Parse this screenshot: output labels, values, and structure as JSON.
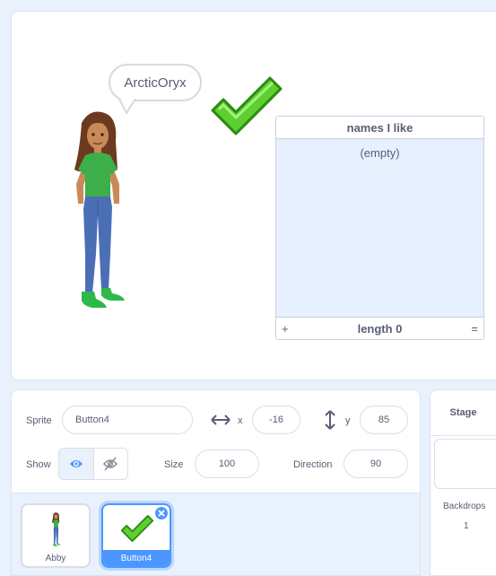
{
  "stage": {
    "speech_bubble_text": "ArcticOryx",
    "list_monitor": {
      "title": "names I like",
      "empty_text": "(empty)",
      "add_symbol": "+",
      "length_text": "length 0",
      "resize_symbol": "="
    }
  },
  "sprite_info": {
    "sprite_label": "Sprite",
    "sprite_name": "Button4",
    "x_label": "x",
    "x_value": "-16",
    "y_label": "y",
    "y_value": "85",
    "show_label": "Show",
    "size_label": "Size",
    "size_value": "100",
    "direction_label": "Direction",
    "direction_value": "90"
  },
  "sprites": [
    {
      "name": "Abby",
      "selected": false
    },
    {
      "name": "Button4",
      "selected": true
    }
  ],
  "stage_panel": {
    "tab_label": "Stage",
    "backdrops_label": "Backdrops",
    "backdrops_count": "1"
  },
  "colors": {
    "accent": "#4c97ff",
    "check_green": "#5ecf2f",
    "panel_bg": "#e9f1fc",
    "list_bg": "#e6f0ff"
  }
}
